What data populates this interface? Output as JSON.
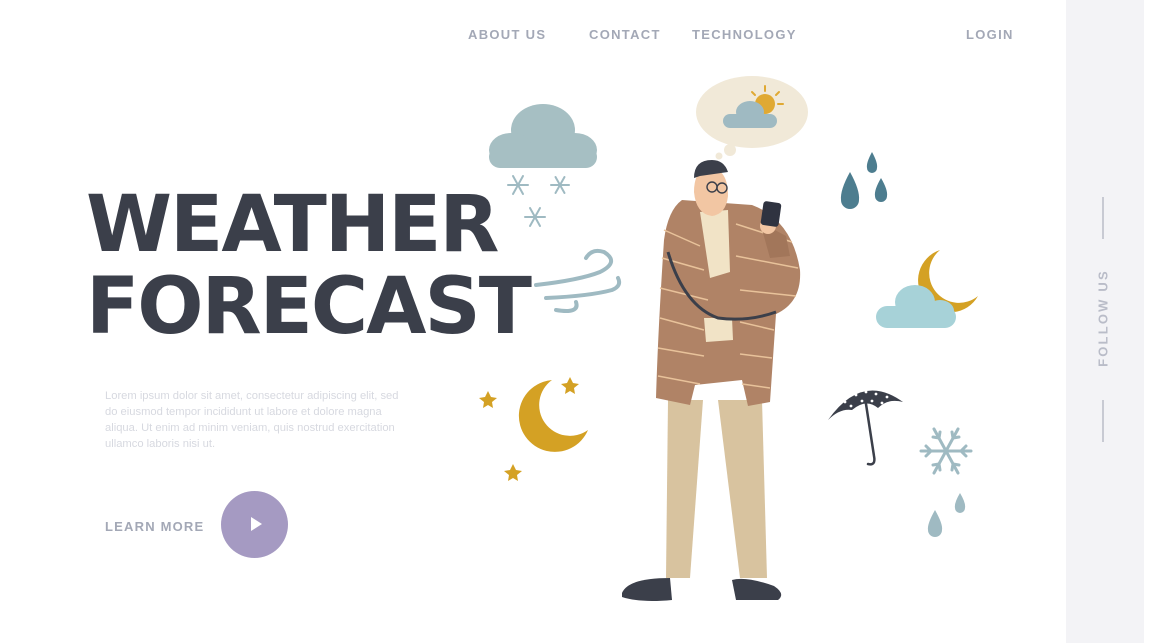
{
  "nav": {
    "about": "ABOUT US",
    "contact": "CONTACT",
    "technology": "TECHNOLOGY",
    "login": "LOGIN"
  },
  "hero": {
    "title_line_1": "WEATHER",
    "title_line_2": "FORECAST",
    "description": "Lorem ipsum dolor sit amet, consectetur adipiscing elit, sed do eiusmod tempor incididunt ut labore et dolore magna aliqua. Ut enim ad minim veniam, quis nostrud exercitation ullamco laboris nisi ut.",
    "learn_more": "LEARN MORE"
  },
  "sidebar": {
    "follow_us": "FOLLOW US"
  },
  "icons": [
    "snow-cloud-icon",
    "wind-icon",
    "moon-stars-icon",
    "thought-bubble-sun-cloud-icon",
    "raindrops-icon",
    "moon-cloud-icon",
    "umbrella-icon",
    "snowflake-icon",
    "play-icon"
  ],
  "colors": {
    "title": "#3b3f4a",
    "nav_text": "#a3a8b6",
    "play_button": "#a59ac2",
    "cloud": "#9fb9bf",
    "moon": "#d4a124",
    "jacket": "#b08366",
    "pants": "#d8c39f",
    "sidebar": "#f3f3f6"
  }
}
